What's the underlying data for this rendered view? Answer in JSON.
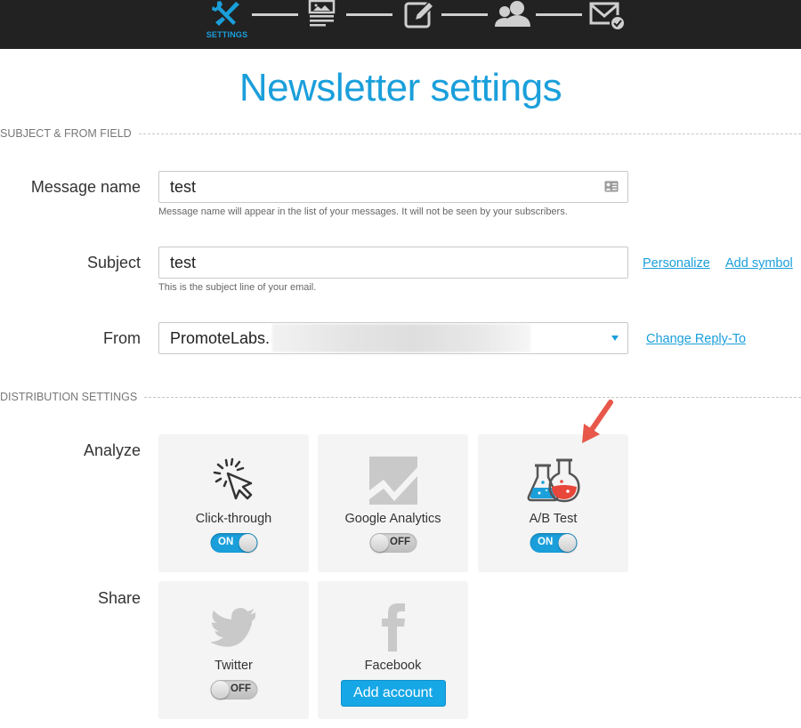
{
  "stepper": {
    "steps": [
      {
        "icon": "settings-tools-icon",
        "label": "SETTINGS",
        "active": true
      },
      {
        "icon": "template-icon",
        "label": "",
        "active": false
      },
      {
        "icon": "edit-icon",
        "label": "",
        "active": false
      },
      {
        "icon": "recipients-icon",
        "label": "",
        "active": false
      },
      {
        "icon": "send-confirm-icon",
        "label": "",
        "active": false
      }
    ]
  },
  "page": {
    "title": "Newsletter settings"
  },
  "sections": {
    "subject_from": "SUBJECT & FROM FIELD",
    "distribution": "DISTRIBUTION SETTINGS"
  },
  "fields": {
    "message_name": {
      "label": "Message name",
      "value": "test",
      "hint": "Message name will appear in the list of your messages. It will not be seen by your subscribers."
    },
    "subject": {
      "label": "Subject",
      "value": "test",
      "hint": "This is the subject line of your email.",
      "links": [
        "Personalize",
        "Add symbol"
      ]
    },
    "from": {
      "label": "From",
      "value": "PromoteLabs.",
      "link": "Change Reply-To"
    }
  },
  "analyze": {
    "label": "Analyze",
    "tiles": [
      {
        "name": "Click-through",
        "icon": "cursor-click-icon",
        "state": "ON"
      },
      {
        "name": "Google Analytics",
        "icon": "analytics-chart-icon",
        "state": "OFF"
      },
      {
        "name": "A/B Test",
        "icon": "flasks-icon",
        "state": "ON"
      }
    ]
  },
  "share": {
    "label": "Share",
    "tiles": [
      {
        "name": "Twitter",
        "icon": "twitter-icon",
        "state": "OFF"
      },
      {
        "name": "Facebook",
        "icon": "facebook-icon",
        "button": "Add account"
      }
    ]
  },
  "colors": {
    "accent": "#1a9fdb",
    "topbar": "#222222",
    "tile_bg": "#f4f4f4",
    "arrow": "#e8574a"
  }
}
